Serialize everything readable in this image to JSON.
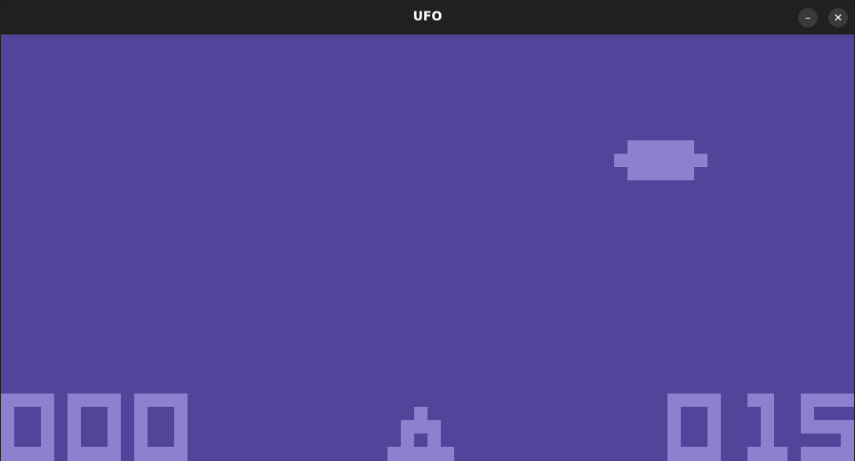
{
  "window": {
    "title": "UFO",
    "minimize_icon": "minimize-icon",
    "minimize_glyph": "–",
    "close_icon": "close-icon",
    "close_glyph": "✕"
  },
  "game": {
    "background_color": "#50459a",
    "sprite_color": "#8c80cf",
    "player_score": "000",
    "time_remaining": "015",
    "ufo_icon": "ufo-saucer-icon",
    "cannon_icon": "laser-cannon-icon"
  }
}
